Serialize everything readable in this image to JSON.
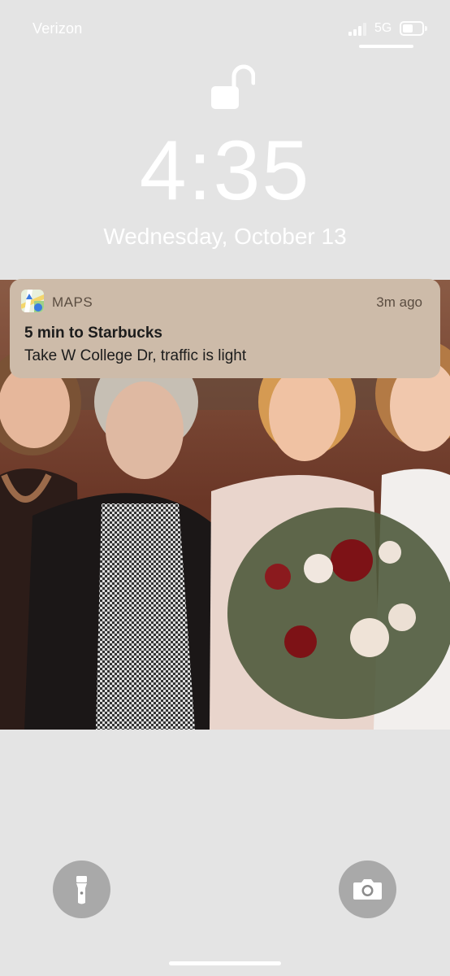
{
  "status_bar": {
    "carrier": "Verizon",
    "network": "5G",
    "signal_bars": 4,
    "battery_level": 0.55,
    "icons": [
      "signal-icon",
      "battery-icon"
    ]
  },
  "lock": {
    "icon": "unlocked-padlock-icon"
  },
  "clock": {
    "time": "4:35",
    "date": "Wednesday, October 13"
  },
  "notification": {
    "app_name": "MAPS",
    "app_icon": "maps-app-icon",
    "time_ago": "3m ago",
    "title": "5 min to Starbucks",
    "body": "Take W College Dr, traffic is light"
  },
  "quick_actions": {
    "left": "flashlight-icon",
    "right": "camera-icon"
  },
  "colors": {
    "notification_bg": "#cdbba9",
    "background": "#e4e4e4"
  }
}
